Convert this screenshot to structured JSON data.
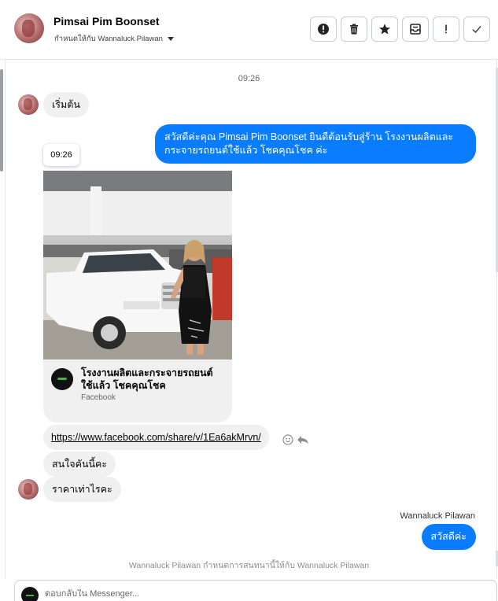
{
  "header": {
    "contact_name": "Pimsai Pim Boonset",
    "assigned_label": "กำหนดให้กับ Wannaluck Pilawan",
    "toolbar_icons": [
      "alert-circle-icon",
      "trash-icon",
      "star-icon",
      "archive-icon",
      "exclamation-icon",
      "check-icon"
    ]
  },
  "conversation": {
    "timestamp": "09:26",
    "messages": [
      {
        "id": "m1",
        "direction": "in",
        "text": "เริ่มต้น"
      },
      {
        "id": "m2",
        "direction": "out",
        "text": "สวัสดีค่ะคุณ Pimsai Pim Boonset ยินดีต้อนรับสู่ร้าน โรงงานผลิตและกระจายรถยนต์ใช้แล้ว โชคคุณโชค ค่ะ"
      },
      {
        "id": "m3",
        "direction": "in",
        "type": "link_card",
        "hover_time": "09:26",
        "card": {
          "title": "โรงงานผลิตและกระจายรถยนต์ใช้แล้ว โชคคุณโชค",
          "source": "Facebook"
        }
      },
      {
        "id": "m4",
        "direction": "in",
        "text": "https://www.facebook.com/share/v/1Ea6akMrvn/"
      },
      {
        "id": "m5",
        "direction": "in",
        "text": "สนใจคันนี้คะ"
      },
      {
        "id": "m6",
        "direction": "in",
        "text": "ราคาเท่าไรคะ"
      },
      {
        "id": "m7",
        "direction": "out",
        "sender": "Wannaluck Pilawan",
        "text": "สวัสดีค่ะ"
      }
    ],
    "system_note": "Wannaluck Pilawan กำหนดการสนทนานี้ให้กับ Wannaluck Pilawan"
  },
  "composer": {
    "placeholder": "ตอบกลับใน Messenger..."
  },
  "colors": {
    "outgoing_bubble": "#0a7cff",
    "incoming_bubble": "#f0f0f0"
  }
}
